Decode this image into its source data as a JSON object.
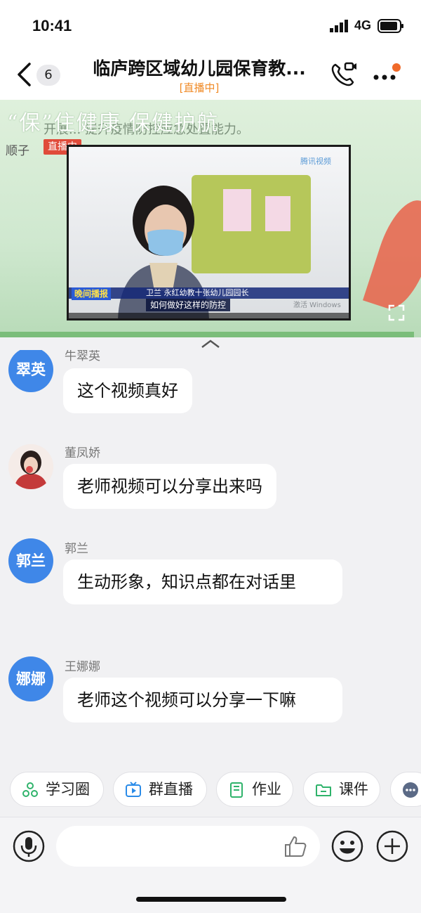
{
  "status": {
    "time": "10:41",
    "network": "4G"
  },
  "header": {
    "unread_count": "6",
    "title": "临庐跨区域幼儿园保育教...",
    "subtitle": "[直播中]"
  },
  "live": {
    "banner": "“保”住健康 保健护航",
    "banner_sub": "开展... 提升疫情防控应急处置能力。",
    "host": "顺子",
    "live_badge": "直播中",
    "video": {
      "tag": "晚间播报",
      "caption_line1": "卫兰 永红幼教十张幼儿园园长",
      "caption_line2": "如何做好这样的防控",
      "channel_logo": "腾讯视频",
      "watermark": "激活 Windows"
    }
  },
  "chat": {
    "messages": [
      {
        "avatar_text": "翠英",
        "name": "牛翠英",
        "text": "这个视频真好"
      },
      {
        "avatar_text": "",
        "name": "董凤娇",
        "text": "老师视频可以分享出来吗"
      },
      {
        "avatar_text": "郭兰",
        "name": "郭兰",
        "text": "生动形象，知识点都在对话里"
      },
      {
        "avatar_text": "娜娜",
        "name": "王娜娜",
        "text": "老师这个视频可以分享一下嘛"
      }
    ]
  },
  "quick_actions": [
    {
      "label": "学习圈",
      "icon": "study-circle-icon",
      "color": "#2fb36b"
    },
    {
      "label": "群直播",
      "icon": "group-live-icon",
      "color": "#2a8be8"
    },
    {
      "label": "作业",
      "icon": "homework-icon",
      "color": "#2fb36b"
    },
    {
      "label": "课件",
      "icon": "courseware-icon",
      "color": "#2fb36b"
    }
  ],
  "colors": {
    "accent_orange": "#f08a26",
    "avatar_blue": "#3f87e8",
    "live_red": "#e04b3a"
  }
}
